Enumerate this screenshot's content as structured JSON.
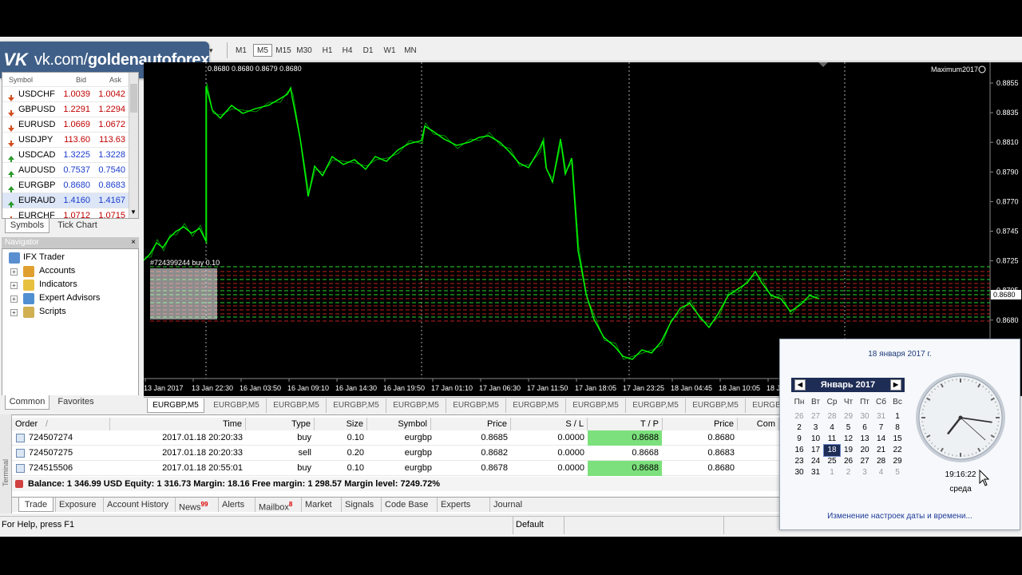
{
  "colors": {
    "chart_bg": "#000000",
    "candle_line": "#00ff00",
    "buy_tp": "#7ce07c",
    "vk_blue": "#3f5f88",
    "cal_header": "#1e2d56"
  },
  "banner": {
    "logo": "VK",
    "text_plain": "vk.com/",
    "text_bold": "goldenautoforex"
  },
  "toolbar": {
    "timeframes": [
      "M1",
      "M5",
      "M15",
      "M30",
      "H1",
      "H4",
      "D1",
      "W1",
      "MN"
    ],
    "selected": "M5"
  },
  "market_watch": {
    "headers": {
      "symbol": "Symbol",
      "bid": "Bid",
      "ask": "Ask"
    },
    "rows": [
      {
        "symbol": "USDCHF",
        "bid": "1.0039",
        "ask": "1.0042",
        "dir": "down"
      },
      {
        "symbol": "GBPUSD",
        "bid": "1.2291",
        "ask": "1.2294",
        "dir": "down"
      },
      {
        "symbol": "EURUSD",
        "bid": "1.0669",
        "ask": "1.0672",
        "dir": "down"
      },
      {
        "symbol": "USDJPY",
        "bid": "113.60",
        "ask": "113.63",
        "dir": "down"
      },
      {
        "symbol": "USDCAD",
        "bid": "1.3225",
        "ask": "1.3228",
        "dir": "up"
      },
      {
        "symbol": "AUDUSD",
        "bid": "0.7537",
        "ask": "0.7540",
        "dir": "up"
      },
      {
        "symbol": "EURGBP",
        "bid": "0.8680",
        "ask": "0.8683",
        "dir": "up"
      },
      {
        "symbol": "EURAUD",
        "bid": "1.4160",
        "ask": "1.4167",
        "dir": "up"
      },
      {
        "symbol": "EURCHF",
        "bid": "1.0712",
        "ask": "1.0715",
        "dir": "down"
      }
    ],
    "tabs": [
      "Symbols",
      "Tick Chart"
    ]
  },
  "navigator": {
    "title": "Navigator",
    "root": "IFX Trader",
    "items": [
      "Accounts",
      "Indicators",
      "Expert Advisors",
      "Scripts"
    ],
    "tabs": [
      "Common",
      "Favorites"
    ]
  },
  "chart": {
    "ohlc_header": "0.8680 0.8680 0.8679 0.8680",
    "indicator_label": "Maximum2017",
    "order_label": "#724399244 buy 0.10",
    "price_badge": "0.8680",
    "price_axis": [
      "0.8855",
      "0.8835",
      "0.8810",
      "0.8790",
      "0.8770",
      "0.8745",
      "0.8725",
      "0.8705",
      "0.8680",
      "0.8660",
      "0.8640"
    ],
    "time_axis": [
      "13 Jan 2017",
      "13 Jan 22:30",
      "16 Jan 03:50",
      "16 Jan 09:10",
      "16 Jan 14:30",
      "16 Jan 19:50",
      "17 Jan 01:10",
      "17 Jan 06:30",
      "17 Jan 11:50",
      "17 Jan 18:05",
      "17 Jan 23:25",
      "18 Jan 04:45",
      "18 Jan 10:05",
      "18 Ja"
    ]
  },
  "chart_tabs": [
    "EURGBP,M5",
    "EURGBP,M5",
    "EURGBP,M5",
    "EURGBP,M5",
    "EURGBP,M5",
    "EURGBP,M5",
    "EURGBP,M5",
    "EURGBP,M5",
    "EURGBP,M5",
    "EURGBP,M5",
    "EURGBP,M5"
  ],
  "terminal": {
    "strip_label": "Terminal",
    "headers": [
      "Order",
      "/",
      "Time",
      "Type",
      "Size",
      "Symbol",
      "Price",
      "S / L",
      "T / P",
      "Price",
      "Com"
    ],
    "rows": [
      {
        "order": "724507274",
        "time": "2017.01.18 20:20:33",
        "type": "buy",
        "size": "0.10",
        "symbol": "eurgbp",
        "price": "0.8685",
        "sl": "0.0000",
        "tp": "0.8688",
        "cur": "0.8680",
        "tp_highlight": true
      },
      {
        "order": "724507275",
        "time": "2017.01.18 20:20:33",
        "type": "sell",
        "size": "0.20",
        "symbol": "eurgbp",
        "price": "0.8682",
        "sl": "0.0000",
        "tp": "0.8668",
        "cur": "0.8683",
        "tp_highlight": false
      },
      {
        "order": "724515506",
        "time": "2017.01.18 20:55:01",
        "type": "buy",
        "size": "0.10",
        "symbol": "eurgbp",
        "price": "0.8678",
        "sl": "0.0000",
        "tp": "0.8688",
        "cur": "0.8680",
        "tp_highlight": true
      }
    ],
    "balance": "Balance: 1 346.99 USD  Equity: 1 316.73  Margin: 18.16  Free margin: 1 298.57  Margin level: 7249.72%",
    "tabs": [
      {
        "label": "Trade",
        "badge": ""
      },
      {
        "label": "Exposure",
        "badge": ""
      },
      {
        "label": "Account History",
        "badge": ""
      },
      {
        "label": "News",
        "badge": "99"
      },
      {
        "label": "Alerts",
        "badge": ""
      },
      {
        "label": "Mailbox",
        "badge": "8"
      },
      {
        "label": "Market",
        "badge": ""
      },
      {
        "label": "Signals",
        "badge": ""
      },
      {
        "label": "Code Base",
        "badge": ""
      },
      {
        "label": "Experts",
        "badge": ""
      },
      {
        "label": "Journal",
        "badge": ""
      }
    ]
  },
  "status": {
    "help": "For Help, press F1",
    "profile": "Default"
  },
  "calendar": {
    "full_date": "18 января 2017 г.",
    "month": "Январь 2017",
    "weekdays": [
      "Пн",
      "Вт",
      "Ср",
      "Чт",
      "Пт",
      "Сб",
      "Вс"
    ],
    "weeks": [
      [
        "26",
        "27",
        "28",
        "29",
        "30",
        "31",
        "1"
      ],
      [
        "2",
        "3",
        "4",
        "5",
        "6",
        "7",
        "8"
      ],
      [
        "9",
        "10",
        "11",
        "12",
        "13",
        "14",
        "15"
      ],
      [
        "16",
        "17",
        "18",
        "19",
        "20",
        "21",
        "22"
      ],
      [
        "23",
        "24",
        "25",
        "26",
        "27",
        "28",
        "29"
      ],
      [
        "30",
        "31",
        "1",
        "2",
        "3",
        "4",
        "5"
      ]
    ],
    "today": "18",
    "time": "19:16:22",
    "weekday_name": "среда",
    "settings_link": "Изменение настроек даты и времени..."
  }
}
